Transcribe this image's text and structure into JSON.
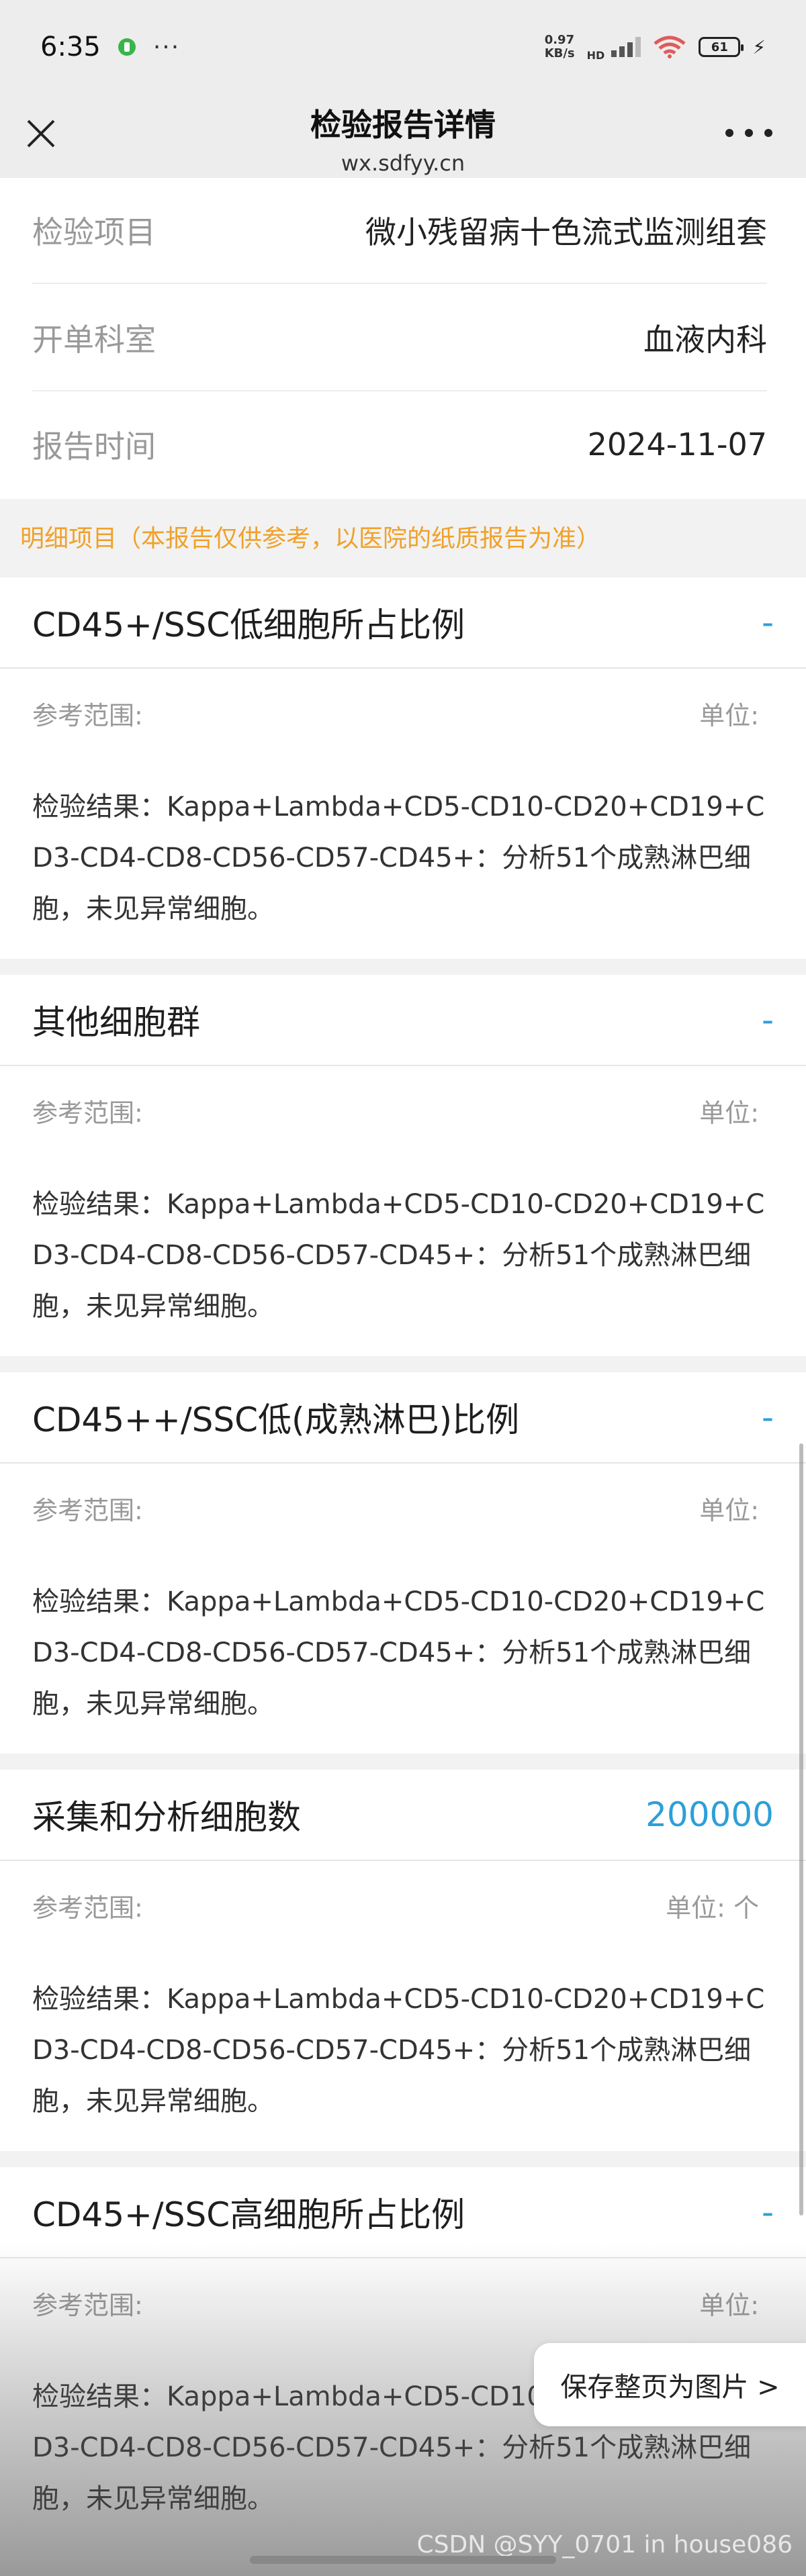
{
  "status_bar": {
    "time": "6:35",
    "more": "···",
    "net_speed_value": "0.97",
    "net_speed_unit": "KB/s",
    "hd": "HD",
    "battery": "61",
    "wifi_sub": "6"
  },
  "nav": {
    "title": "检验报告详情",
    "url": "wx.sdfyy.cn"
  },
  "info": [
    {
      "label": "检验项目",
      "value": "微小残留病十色流式监测组套"
    },
    {
      "label": "开单科室",
      "value": "血液内科"
    },
    {
      "label": "报告时间",
      "value": "2024-11-07"
    }
  ],
  "notice": "明细项目（本报告仅供参考，以医院的纸质报告为准）",
  "items": [
    {
      "title": "CD45+/SSC低细胞所占比例",
      "value": "-",
      "ref_label": "参考范围:",
      "unit_label": "单位:",
      "result": "检验结果：Kappa+Lambda+CD5-CD10-CD20+CD19+CD3-CD4-CD8-CD56-CD57-CD45+：分析51个成熟淋巴细胞，未见异常细胞。"
    },
    {
      "title": "其他细胞群",
      "value": "-",
      "ref_label": "参考范围:",
      "unit_label": "单位:",
      "result": "检验结果：Kappa+Lambda+CD5-CD10-CD20+CD19+CD3-CD4-CD8-CD56-CD57-CD45+：分析51个成熟淋巴细胞，未见异常细胞。"
    },
    {
      "title": "CD45++/SSC低(成熟淋巴)比例",
      "value": "-",
      "ref_label": "参考范围:",
      "unit_label": "单位:",
      "result": "检验结果：Kappa+Lambda+CD5-CD10-CD20+CD19+CD3-CD4-CD8-CD56-CD57-CD45+：分析51个成熟淋巴细胞，未见异常细胞。"
    },
    {
      "title": "采集和分析细胞数",
      "value": "200000",
      "ref_label": "参考范围:",
      "unit_label": "单位: 个",
      "result": "检验结果：Kappa+Lambda+CD5-CD10-CD20+CD19+CD3-CD4-CD8-CD56-CD57-CD45+：分析51个成熟淋巴细胞，未见异常细胞。"
    },
    {
      "title": "CD45+/SSC高细胞所占比例",
      "value": "-",
      "ref_label": "参考范围:",
      "unit_label": "单位:",
      "result": "检验结果：Kappa+Lambda+CD5-CD10-CD20+CD19+CD3-CD4-CD8-CD56-CD57-CD45+：分析51个成熟淋巴细胞，未见异常细胞。"
    }
  ],
  "save_button": "保存整页为图片 >",
  "watermark": "CSDN @SYY_0701 in house086",
  "colors": {
    "accent": "#2d9fd8",
    "notice": "#f0a12a",
    "label": "#999999",
    "background": "#f2f2f2"
  }
}
